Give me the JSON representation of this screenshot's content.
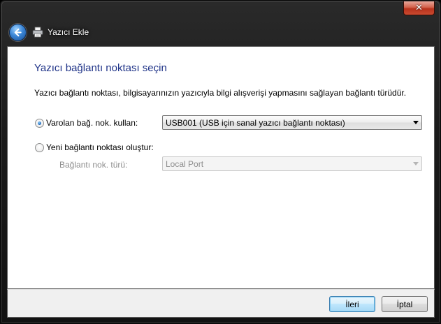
{
  "window": {
    "title": "Yazıcı Ekle",
    "close_label": "✕"
  },
  "page": {
    "heading": "Yazıcı bağlantı noktası seçin",
    "description": "Yazıcı bağlantı noktası, bilgisayarınızın yazıcıyla bilgi alışverişi yapmasını sağlayan bağlantı türüdür."
  },
  "options": {
    "existing": {
      "label": "Varolan bağ. nok. kullan:",
      "checked": true,
      "selected_value": "USB001 (USB için sanal yazıcı bağlantı noktası)"
    },
    "new": {
      "label": "Yeni bağlantı noktası oluştur:",
      "checked": false,
      "type_label": "Bağlantı nok. türü:",
      "type_value": "Local Port"
    }
  },
  "footer": {
    "next_label": "İleri",
    "cancel_label": "İptal"
  },
  "icons": {
    "back": "back-arrow-icon",
    "printer": "printer-icon",
    "close": "close-icon"
  },
  "colors": {
    "heading": "#1e3287",
    "close_button": "#c94a30",
    "default_button": "#bee6fd"
  }
}
